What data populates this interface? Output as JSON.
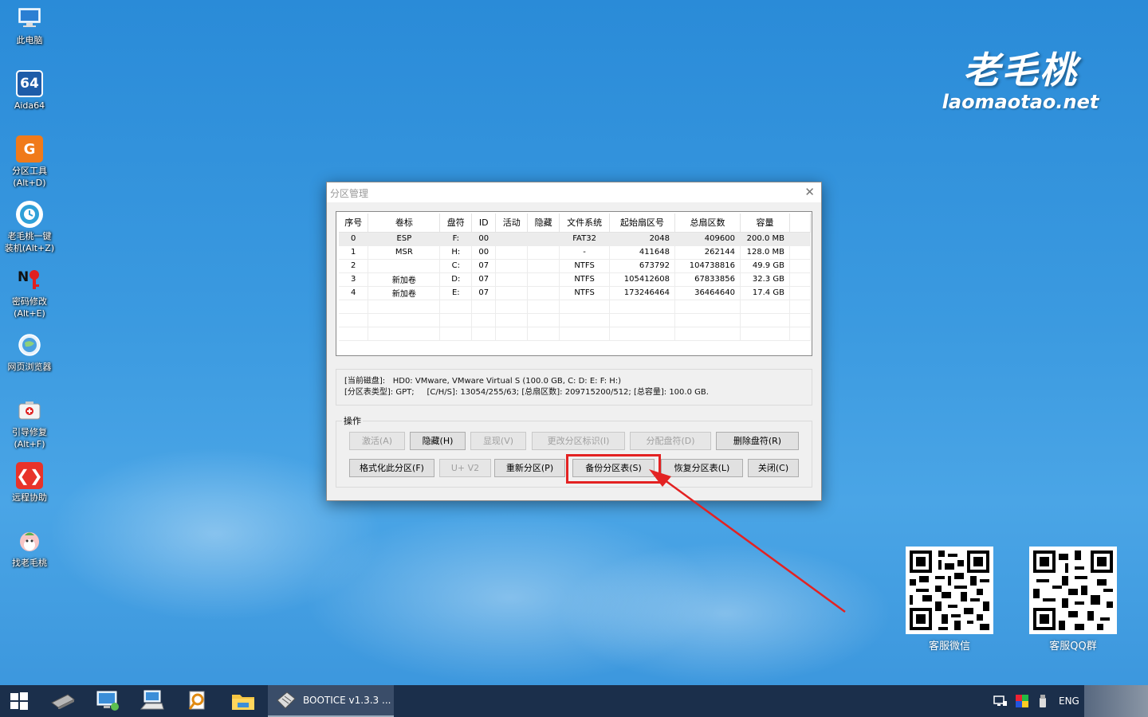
{
  "desktop": {
    "icons": [
      {
        "label": "此电脑",
        "icon": "computer-icon"
      },
      {
        "label": "Aida64",
        "icon": "aida64-icon"
      },
      {
        "label": "分区工具\n(Alt+D)",
        "icon": "partition-tool-icon"
      },
      {
        "label": "老毛桃一键\n装机(Alt+Z)",
        "icon": "install-icon"
      },
      {
        "label": "密码修改\n(Alt+E)",
        "icon": "password-icon"
      },
      {
        "label": "网页浏览器",
        "icon": "browser-icon"
      },
      {
        "label": "引导修复\n(Alt+F)",
        "icon": "boot-repair-icon"
      },
      {
        "label": "远程协助",
        "icon": "remote-assist-icon"
      },
      {
        "label": "找老毛桃",
        "icon": "find-laomaotao-icon"
      }
    ]
  },
  "logo": {
    "cn": "老毛桃",
    "en": "laomaotao.net"
  },
  "qr": [
    {
      "caption": "客服微信"
    },
    {
      "caption": "客服QQ群"
    }
  ],
  "dialog": {
    "title": "分区管理",
    "columns": [
      "序号",
      "卷标",
      "盘符",
      "ID",
      "活动",
      "隐藏",
      "文件系统",
      "起始扇区号",
      "总扇区数",
      "容量"
    ],
    "rows": [
      [
        "0",
        "ESP",
        "F:",
        "00",
        "",
        "",
        "FAT32",
        "2048",
        "409600",
        "200.0 MB"
      ],
      [
        "1",
        "MSR",
        "H:",
        "00",
        "",
        "",
        "-",
        "411648",
        "262144",
        "128.0 MB"
      ],
      [
        "2",
        "",
        "C:",
        "07",
        "",
        "",
        "NTFS",
        "673792",
        "104738816",
        "49.9 GB"
      ],
      [
        "3",
        "新加卷",
        "D:",
        "07",
        "",
        "",
        "NTFS",
        "105412608",
        "67833856",
        "32.3 GB"
      ],
      [
        "4",
        "新加卷",
        "E:",
        "07",
        "",
        "",
        "NTFS",
        "173246464",
        "36464640",
        "17.4 GB"
      ]
    ],
    "info": {
      "disk_label": "[当前磁盘]:",
      "disk_value": "HD0: VMware, VMware Virtual S (100.0 GB, C: D: E: F: H:)",
      "type_label": "[分区表类型]:",
      "type_value": "GPT;     [C/H/S]: 13054/255/63; [总扇区数]: 209715200/512; [总容量]: 100.0 GB."
    },
    "ops_title": "操作",
    "buttons": {
      "activate": "激活(A)",
      "hide": "隐藏(H)",
      "show": "显现(V)",
      "change_id": "更改分区标识(I)",
      "assign_letter": "分配盘符(D)",
      "delete_letter": "删除盘符(R)",
      "format": "格式化此分区(F)",
      "uv2": "U+ V2",
      "repartition": "重新分区(P)",
      "backup": "备份分区表(S)",
      "restore": "恢复分区表(L)",
      "close": "关闭(C)"
    }
  },
  "taskbar": {
    "active_app": "BOOTICE v1.3.3 ...",
    "language": "ENG"
  }
}
